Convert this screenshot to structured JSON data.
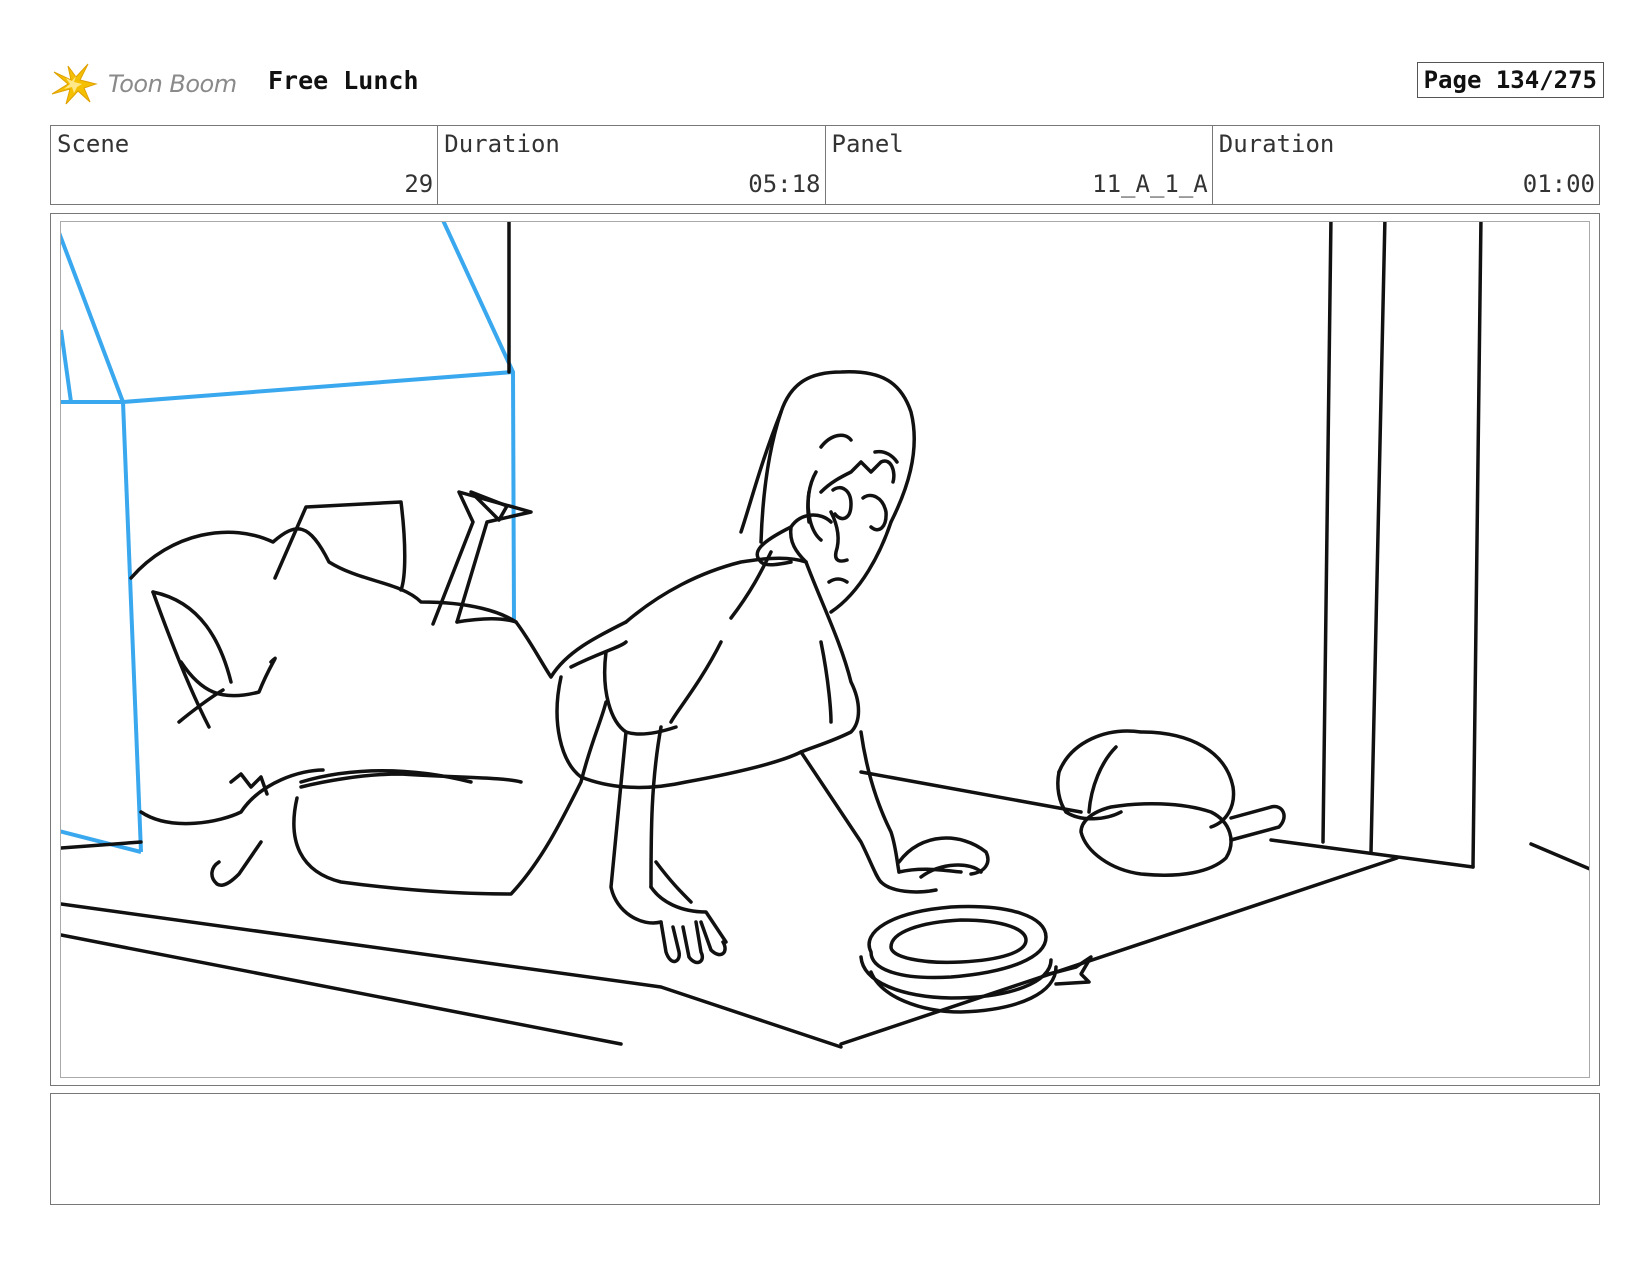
{
  "header": {
    "logo_text": "Toon Boom",
    "project_title": "Free Lunch",
    "page_label": "Page 134/275"
  },
  "info": {
    "scene_label": "Scene",
    "scene_value": "29",
    "scene_duration_label": "Duration",
    "scene_duration_value": "05:18",
    "panel_label": "Panel",
    "panel_value": "11_A_1_A",
    "panel_duration_label": "Duration",
    "panel_duration_value": "01:00"
  },
  "panel": {
    "image_icon": "storyboard-sketch",
    "line_color": "#111111",
    "guide_color": "#3aa8ee"
  },
  "notes": {
    "text": ""
  },
  "colors": {
    "logo_star": "#f5c000",
    "logo_text": "#8a8a8a",
    "border": "#777777"
  }
}
